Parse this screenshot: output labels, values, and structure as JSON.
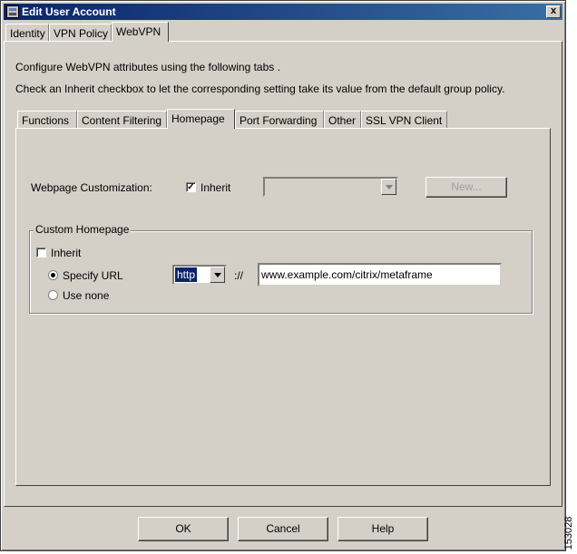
{
  "window": {
    "title": "Edit User Account",
    "close_label": "x"
  },
  "top_tabs": [
    {
      "label": "Identity"
    },
    {
      "label": "VPN Policy"
    },
    {
      "label": "WebVPN"
    }
  ],
  "intro": {
    "line1": "Configure WebVPN attributes using the following tabs .",
    "line2": "Check an Inherit checkbox to let the corresponding setting take its value from the default group policy."
  },
  "sub_tabs": [
    {
      "label": "Functions"
    },
    {
      "label": "Content Filtering"
    },
    {
      "label": "Homepage"
    },
    {
      "label": "Port Forwarding"
    },
    {
      "label": "Other"
    },
    {
      "label": "SSL VPN Client"
    }
  ],
  "customization": {
    "label": "Webpage Customization:",
    "inherit_label": "Inherit",
    "inherit_checked": true,
    "select_value": "",
    "new_button": "New..."
  },
  "custom_homepage": {
    "group_label": "Custom Homepage",
    "inherit_label": "Inherit",
    "inherit_checked": false,
    "specify_url_label": "Specify URL",
    "use_none_label": "Use none",
    "selected_option": "specify_url",
    "protocol_value": "http",
    "separator": "://",
    "url_value": "www.example.com/citrix/metaframe"
  },
  "buttons": {
    "ok": "OK",
    "cancel": "Cancel",
    "help": "Help"
  },
  "figure_id": "153028",
  "colors": {
    "title_bar_start": "#0a246a",
    "title_bar_end": "#3a6ea5",
    "window_face": "#d4d0c8",
    "selection": "#0a246a"
  }
}
